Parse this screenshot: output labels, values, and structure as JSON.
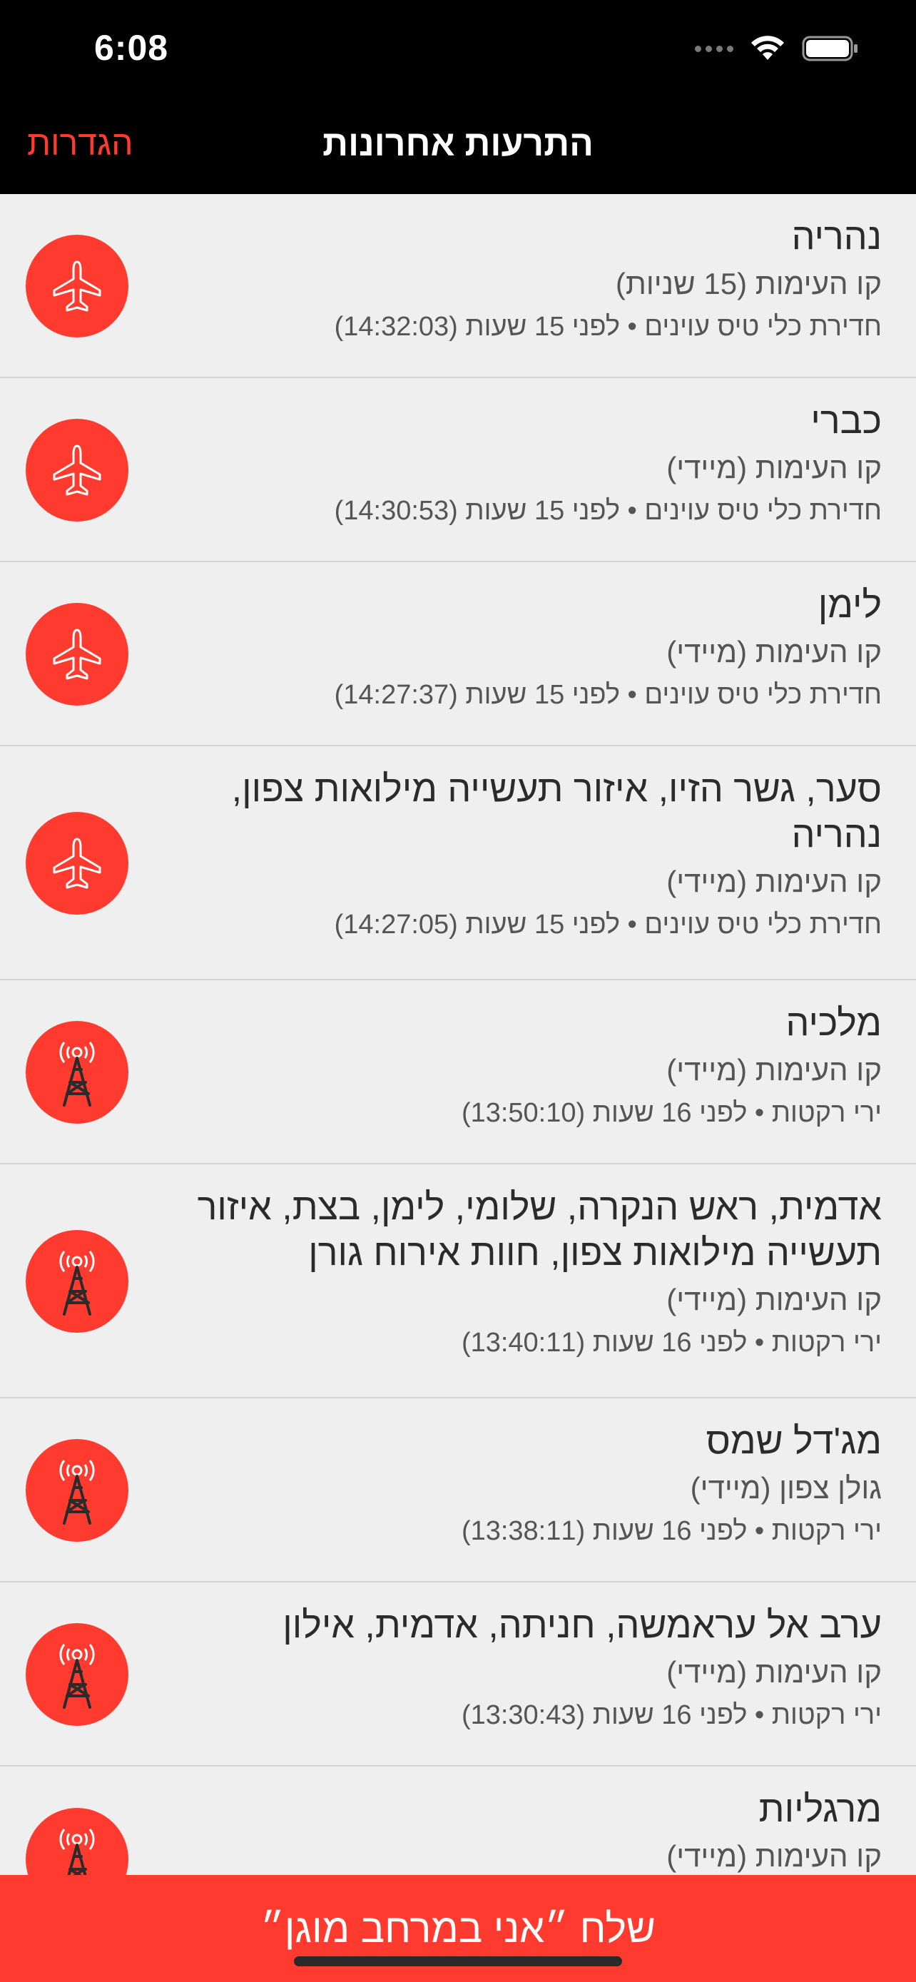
{
  "status_bar": {
    "time": "6:08"
  },
  "nav": {
    "title": "התרעות אחרונות",
    "settings_label": "הגדרות"
  },
  "alerts": [
    {
      "city": "נהריה",
      "area": "קו העימות (15 שניות)",
      "meta": "חדירת כלי טיס עוינים • לפני 15 שעות (14:32:03)",
      "icon": "plane-icon"
    },
    {
      "city": "כברי",
      "area": "קו העימות (מיידי)",
      "meta": "חדירת כלי טיס עוינים • לפני 15 שעות (14:30:53)",
      "icon": "plane-icon"
    },
    {
      "city": "לימן",
      "area": "קו העימות (מיידי)",
      "meta": "חדירת כלי טיס עוינים • לפני 15 שעות (14:27:37)",
      "icon": "plane-icon"
    },
    {
      "city": "סער, גשר הזיו, איזור תעשייה מילואות צפון, נהריה",
      "area": "קו העימות (מיידי)",
      "meta": "חדירת כלי טיס עוינים • לפני 15 שעות (14:27:05)",
      "icon": "plane-icon"
    },
    {
      "city": "מלכיה",
      "area": "קו העימות (מיידי)",
      "meta": "ירי רקטות • לפני 16 שעות (13:50:10)",
      "icon": "rocket-tower-icon"
    },
    {
      "city": "אדמית, ראש הנקרה, שלומי, לימן, בצת, איזור תעשייה מילואות צפון, חוות אירוח גורן",
      "area": "קו העימות (מיידי)",
      "meta": "ירי רקטות • לפני 16 שעות (13:40:11)",
      "icon": "rocket-tower-icon"
    },
    {
      "city": "מג'דל שמס",
      "area": "גולן צפון (מיידי)",
      "meta": "ירי רקטות • לפני 16 שעות (13:38:11)",
      "icon": "rocket-tower-icon"
    },
    {
      "city": "ערב אל עראמשה, חניתה, אדמית, אילון",
      "area": "קו העימות (מיידי)",
      "meta": "ירי רקטות • לפני 16 שעות (13:30:43)",
      "icon": "rocket-tower-icon"
    },
    {
      "city": "מרגליות",
      "area": "קו העימות (מיידי)",
      "meta": "",
      "icon": "rocket-tower-icon"
    }
  ],
  "bottom_button": {
    "label": "שלח ״אני במרחב מוגן״"
  },
  "colors": {
    "accent": "#ff3b30",
    "list_bg": "#efefef",
    "header_bg": "#000000"
  }
}
